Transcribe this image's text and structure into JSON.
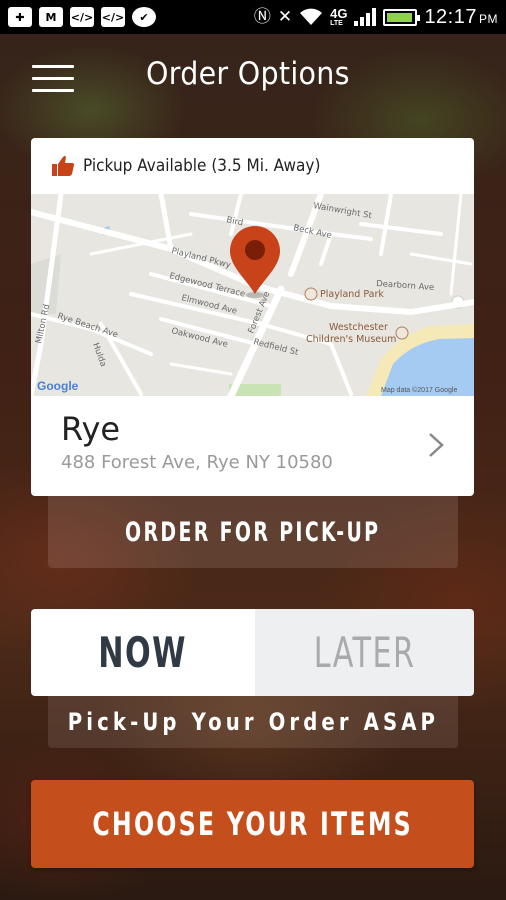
{
  "status_bar": {
    "icons": [
      "plus-icon",
      "gmail-icon",
      "code-icon",
      "code-icon",
      "chat-icon",
      "nfc-icon",
      "mute-icon",
      "wifi-icon"
    ],
    "network_label": "4G",
    "network_sublabel": "LTE",
    "battery_level": 0.95,
    "time": "12:17",
    "time_suffix": "PM"
  },
  "header": {
    "menu_icon": "hamburger-icon",
    "title": "Order Options"
  },
  "location_card": {
    "availability_icon": "thumbs-up-icon",
    "availability_text": "Pickup Available (3.5 Mi. Away)",
    "map": {
      "pin_icon": "map-pin-icon",
      "labels": {
        "playland_park": "Playland Park",
        "museum_line1": "Westchester",
        "museum_line2": "Children's Museum",
        "playland_pkwy": "Playland Pkwy",
        "beck_ave": "Beck Ave",
        "wainwright_st": "Wainwright St",
        "edgewood_terrace": "Edgewood Terrace",
        "elmwood_ave": "Elmwood Ave",
        "oakwood_ave": "Oakwood Ave",
        "redfield_st": "Redfield St",
        "rye_beach_ave": "Rye Beach Ave",
        "milton_rd": "Milton Rd",
        "forest_ave": "Forest Ave",
        "dearborn_ave": "Dearborn Ave",
        "hulda": "Hulda",
        "google": "Google",
        "attribution": "Map data ©2017 Google"
      },
      "colors": {
        "land": "#e8e6e1",
        "road": "#ffffff",
        "water": "#a6cbf2",
        "beach": "#f5e9b7",
        "park": "#c9e3b4",
        "pin": "#c8421a"
      }
    },
    "location_name": "Rye",
    "address": "488 Forest Ave, Rye NY 10580",
    "chevron_icon": "chevron-right-icon"
  },
  "order_mode": {
    "label": "ORDER FOR PICK-UP"
  },
  "timing_toggle": {
    "options": [
      {
        "label": "NOW",
        "selected": true
      },
      {
        "label": "LATER",
        "selected": false
      }
    ],
    "description": "Pick-Up Your Order ASAP"
  },
  "cta": {
    "label": "CHOOSE YOUR ITEMS",
    "color": "#c44f1c"
  }
}
